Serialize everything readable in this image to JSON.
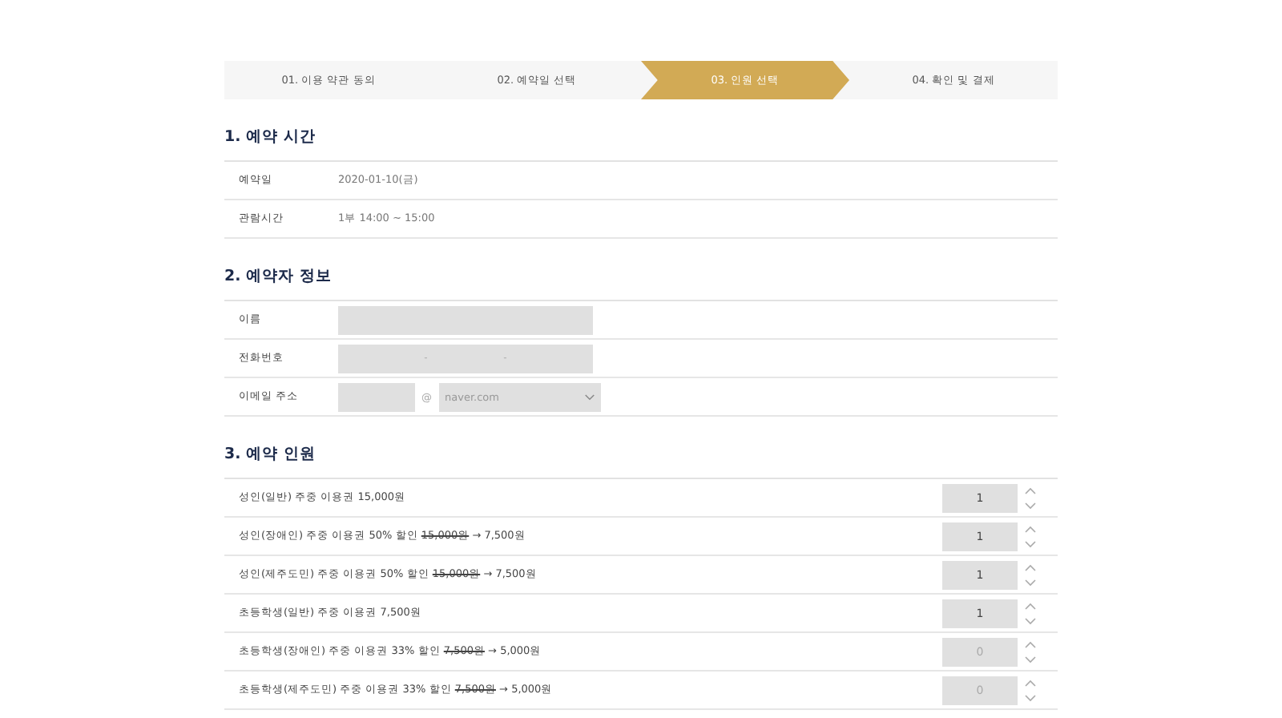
{
  "steps": [
    {
      "label": "01. 이용 약관 동의",
      "selected": false
    },
    {
      "label": "02. 예약일 선택",
      "selected": false
    },
    {
      "label": "03. 인원 선택",
      "selected": true
    },
    {
      "label": "04. 확인 및 결제",
      "selected": false
    }
  ],
  "reservation_time": {
    "title": "1. 예약 시간",
    "rows": [
      {
        "label": "예약일",
        "value": "2020-01-10(금)"
      },
      {
        "label": "관람시간",
        "value": "1부 14:00 ~ 15:00"
      }
    ]
  },
  "booker_info": {
    "title": "2. 예약자 정보",
    "rows": [
      {
        "kind": "name",
        "label": "이름"
      },
      {
        "kind": "phone",
        "label": "전화번호",
        "separators": [
          "-",
          "-"
        ]
      },
      {
        "kind": "email",
        "label": "이메일 주소",
        "at": "@",
        "domain": "naver.com"
      }
    ]
  },
  "headcount": {
    "title": "3. 예약 인원",
    "rows": [
      {
        "text": "성인(일반) 주중 이용권 15,000원",
        "quantity": "1"
      },
      {
        "text": "성인(장애인) 주중 이용권 50% 할인",
        "old_price": "15,000원",
        "arrow": "→",
        "new_price": "7,500원",
        "quantity": "1"
      },
      {
        "text": "성인(제주도민) 주중 이용권 50% 할인",
        "old_price": "15,000원",
        "arrow": "→",
        "new_price": "7,500원",
        "quantity": "1"
      },
      {
        "text": "초등학생(일반) 주중 이용권 7,500원",
        "quantity": "1"
      },
      {
        "text": "초등학생(장애인) 주중 이용권 33% 할인",
        "old_price": "7,500원",
        "arrow": "→",
        "new_price": "5,000원",
        "quantity": "0"
      },
      {
        "text": "초등학생(제주도민) 주중 이용권 33% 할인",
        "old_price": "7,500원",
        "arrow": "→",
        "new_price": "5,000원",
        "quantity": "0"
      }
    ]
  }
}
